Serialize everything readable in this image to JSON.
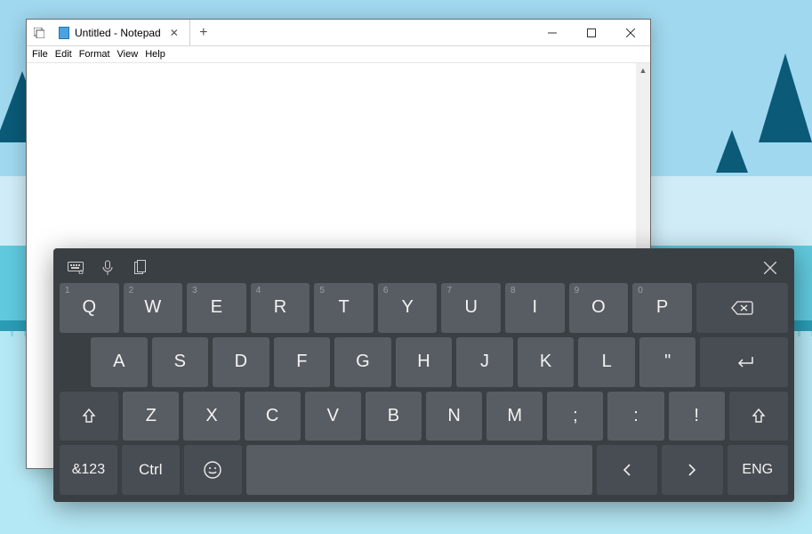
{
  "notepad": {
    "tab_title": "Untitled - Notepad",
    "menus": [
      "File",
      "Edit",
      "Format",
      "View",
      "Help"
    ],
    "text": ""
  },
  "osk": {
    "row1": [
      {
        "hint": "1",
        "label": "Q"
      },
      {
        "hint": "2",
        "label": "W"
      },
      {
        "hint": "3",
        "label": "E"
      },
      {
        "hint": "4",
        "label": "R"
      },
      {
        "hint": "5",
        "label": "T"
      },
      {
        "hint": "6",
        "label": "Y"
      },
      {
        "hint": "7",
        "label": "U"
      },
      {
        "hint": "8",
        "label": "I"
      },
      {
        "hint": "9",
        "label": "O"
      },
      {
        "hint": "0",
        "label": "P"
      }
    ],
    "row2": [
      "A",
      "S",
      "D",
      "F",
      "G",
      "H",
      "J",
      "K",
      "L",
      "\""
    ],
    "row3": [
      "Z",
      "X",
      "C",
      "V",
      "B",
      "N",
      "M",
      ";",
      ":",
      "!"
    ],
    "sym_label": "&123",
    "ctrl_label": "Ctrl",
    "lang_label": "ENG"
  }
}
